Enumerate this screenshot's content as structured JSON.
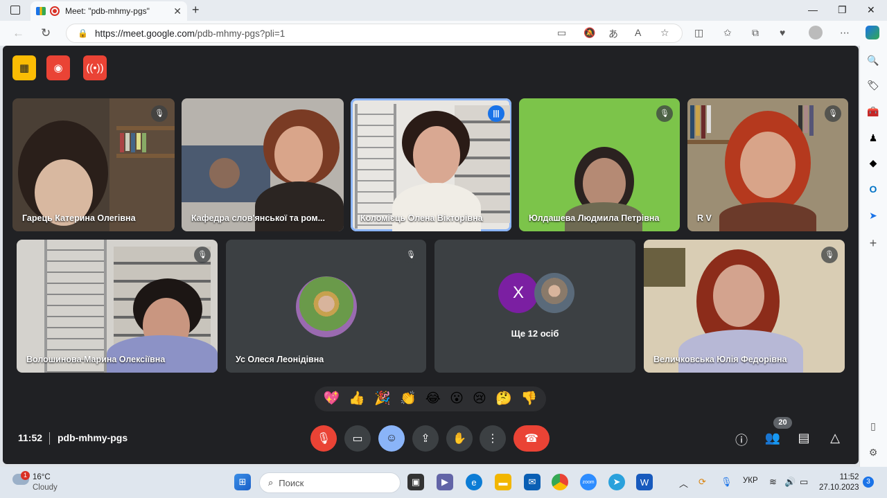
{
  "browser": {
    "tab_title": "Meet: \"pdb-mhmy-pgs\"",
    "url_host": "https://meet.google.com",
    "url_path": "/pdb-mhmy-pgs?pli=1"
  },
  "meet": {
    "meeting_code": "pdb-mhmy-pgs",
    "time": "11:52",
    "participant_count": "20",
    "others_label": "Ще 12 осіб",
    "others_avatar_letter": "X",
    "participants": [
      "Гарець Катерина Олегівна",
      "Кафедра слов'янської та ром...",
      "Коломієць Олена Вікторівна",
      "Юлдашева Людмила Петрівна",
      "R V",
      "Волошинова Марина Олексіївна",
      "Ус Олеся Леонідівна",
      "Величковська Юлія Федорівна"
    ],
    "reactions": [
      "💖",
      "👍",
      "🎉",
      "👏",
      "😂",
      "😮",
      "😢",
      "🤔",
      "👎"
    ]
  },
  "taskbar": {
    "temperature": "16°C",
    "weather": "Cloudy",
    "weather_badge": "1",
    "search_placeholder": "Поиск",
    "lang": "УКР",
    "time": "11:52",
    "date": "27.10.2023",
    "notifications": "3"
  },
  "colors": {
    "meet_bg": "#202124",
    "accent_blue": "#8ab4f8",
    "hangup_red": "#ea4335",
    "host_yellow": "#fbbc04"
  }
}
